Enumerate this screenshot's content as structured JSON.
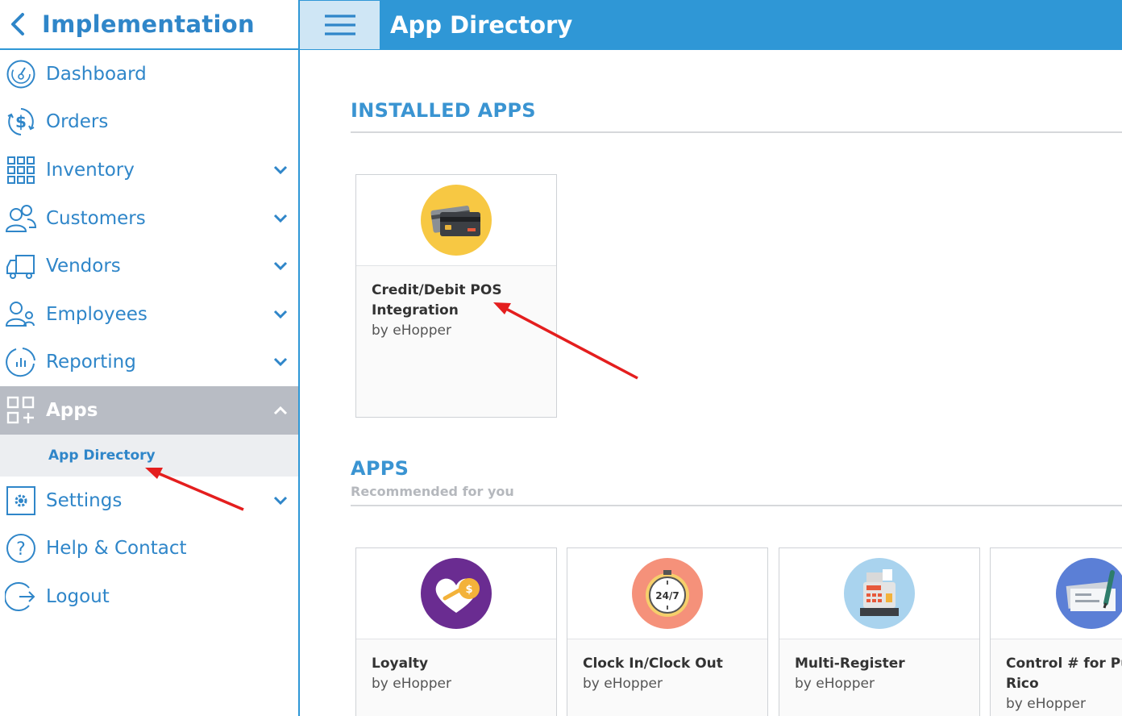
{
  "sidebar": {
    "title": "Implementation",
    "items": [
      {
        "label": "Dashboard",
        "icon": "dashboard-icon"
      },
      {
        "label": "Orders",
        "icon": "dollar-icon"
      },
      {
        "label": "Inventory",
        "icon": "grid-icon"
      },
      {
        "label": "Customers",
        "icon": "customers-icon"
      },
      {
        "label": "Vendors",
        "icon": "truck-icon"
      },
      {
        "label": "Employees",
        "icon": "employees-icon"
      },
      {
        "label": "Reporting",
        "icon": "chart-icon"
      },
      {
        "label": "Apps",
        "icon": "apps-icon"
      },
      {
        "label": "Settings",
        "icon": "gear-icon"
      },
      {
        "label": "Help & Contact",
        "icon": "help-icon"
      },
      {
        "label": "Logout",
        "icon": "logout-icon"
      }
    ],
    "sub_items": [
      {
        "label": "App Directory"
      }
    ]
  },
  "header": {
    "title": "App Directory"
  },
  "installed": {
    "title": "INSTALLED APPS",
    "apps": [
      {
        "name_line1": "Credit/Debit POS",
        "name_line2": "Integration",
        "by": "by eHopper",
        "icon": "credit-card-icon",
        "icon_bg": "#f7c843"
      }
    ]
  },
  "apps": {
    "title": "APPS",
    "subtitle": "Recommended for you",
    "items": [
      {
        "name_line1": "Loyalty",
        "name_line2": "",
        "by": "by eHopper",
        "icon": "loyalty-handshake-icon",
        "icon_bg": "#6a2c91"
      },
      {
        "name_line1": "Clock In/Clock Out",
        "name_line2": "",
        "by": "by eHopper",
        "icon": "clock-24-7-icon",
        "icon_bg": "#f5917a"
      },
      {
        "name_line1": "Multi-Register",
        "name_line2": "",
        "by": "by eHopper",
        "icon": "cash-register-icon",
        "icon_bg": "#a9d3ee"
      },
      {
        "name_line1": "Control # for Puerto",
        "name_line2": "Rico",
        "by": "by eHopper",
        "icon": "check-pen-icon",
        "icon_bg": "#5b7fd6"
      }
    ]
  },
  "colors": {
    "accent": "#2f97d6",
    "sidebar_text": "#2f86c9",
    "active_bg": "#b8bcc4",
    "annotation_arrow": "#e41e1e"
  }
}
